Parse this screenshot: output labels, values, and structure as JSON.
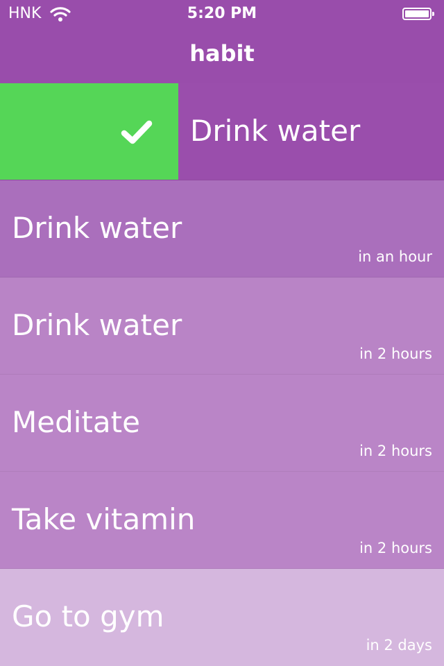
{
  "status_bar": {
    "carrier": "HNK",
    "time": "5:20 PM",
    "wifi_icon": "wifi-icon",
    "battery_icon": "battery-full-icon"
  },
  "nav": {
    "title": "habit"
  },
  "colors": {
    "bar": "#994dab",
    "done": "#55d657"
  },
  "habits": [
    {
      "name": "Drink water",
      "due": "",
      "completed_icon": "checkmark-icon"
    },
    {
      "name": "Drink water",
      "due": "in an hour"
    },
    {
      "name": "Drink water",
      "due": "in 2 hours"
    },
    {
      "name": "Meditate",
      "due": "in 2 hours"
    },
    {
      "name": "Take vitamin",
      "due": "in 2 hours"
    },
    {
      "name": "Go to gym",
      "due": "in 2 days"
    }
  ]
}
